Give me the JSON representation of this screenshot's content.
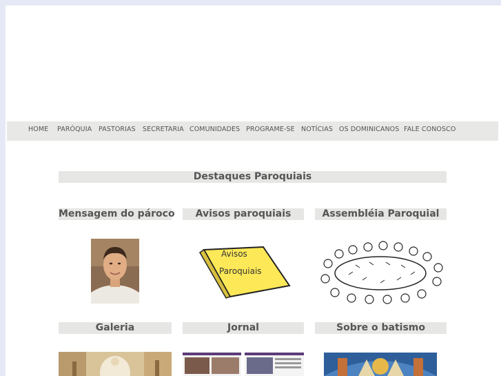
{
  "nav": {
    "items": [
      {
        "label": "HOME"
      },
      {
        "label": "PARÓQUIA"
      },
      {
        "label": "PASTORIAS"
      },
      {
        "label": "SECRETARIA"
      },
      {
        "label": "COMUNIDADES"
      },
      {
        "label": "PROGRAME-SE"
      },
      {
        "label": "NOTÍCIAS"
      },
      {
        "label": "OS DOMINICANOS"
      },
      {
        "label": "FALE CONOSCO"
      }
    ]
  },
  "section": {
    "title": "Destaques Paroquiais"
  },
  "cards": [
    {
      "title": "Mensagem do pároco"
    },
    {
      "title": "Avisos paroquiais",
      "image_text_line1": "Avisos",
      "image_text_line2": "Paroquiais"
    },
    {
      "title": "Assembléia Paroquial"
    },
    {
      "title": "Galeria"
    },
    {
      "title": "Jornal"
    },
    {
      "title": "Sobre o batismo"
    }
  ],
  "colors": {
    "page_background": "#e4e9f5",
    "nav_background": "#e8e8e6",
    "title_bar": "#e6e6e4",
    "text": "#555555",
    "note_yellow": "#fde957"
  },
  "icons": {
    "avisos_image": "yellow-note-icon",
    "assembleia_image": "people-around-table-drawing"
  }
}
